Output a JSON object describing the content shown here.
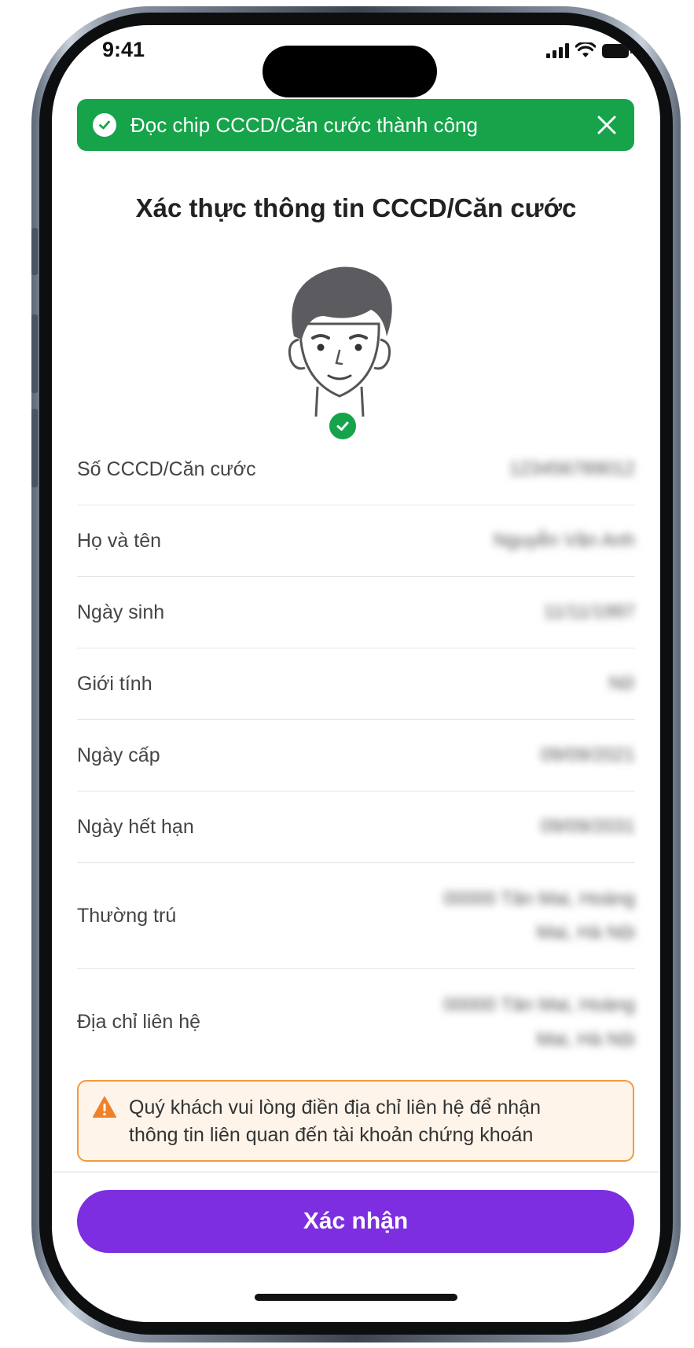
{
  "status_bar": {
    "time": "9:41"
  },
  "toast": {
    "message": "Đọc chip CCCD/Căn cước thành công"
  },
  "page": {
    "title": "Xác thực thông tin CCCD/Căn cước"
  },
  "info_rows": [
    {
      "label": "Số CCCD/Căn cước",
      "value": "123456789012"
    },
    {
      "label": "Họ và tên",
      "value": "Nguyễn Văn Anh"
    },
    {
      "label": "Ngày sinh",
      "value": "11/11/1997"
    },
    {
      "label": "Giới tính",
      "value": "Nữ"
    },
    {
      "label": "Ngày cấp",
      "value": "09/09/2021"
    },
    {
      "label": "Ngày hết hạn",
      "value": "09/09/2031"
    },
    {
      "label": "Thường trú",
      "value_line1": "00000 Tân Mai, Hoàng",
      "value_line2": "Mai, Hà Nội"
    },
    {
      "label": "Địa chỉ liên hệ",
      "value_line1": "00000 Tân Mai, Hoàng",
      "value_line2": "Mai, Hà Nội"
    }
  ],
  "warning": {
    "line1": "Quý khách vui lòng điền địa chỉ liên hệ để nhận",
    "line2": "thông tin liên quan đến tài khoản chứng khoán"
  },
  "actions": {
    "confirm_label": "Xác nhận"
  },
  "colors": {
    "success": "#16a34a",
    "primary": "#7c2ee0",
    "warning": "#f39a3d",
    "warning_bg": "#fff4ea"
  },
  "icons": [
    "check-circle-icon",
    "close-icon",
    "avatar-illustration",
    "warning-icon",
    "signal-icon",
    "wifi-icon",
    "battery-icon"
  ]
}
